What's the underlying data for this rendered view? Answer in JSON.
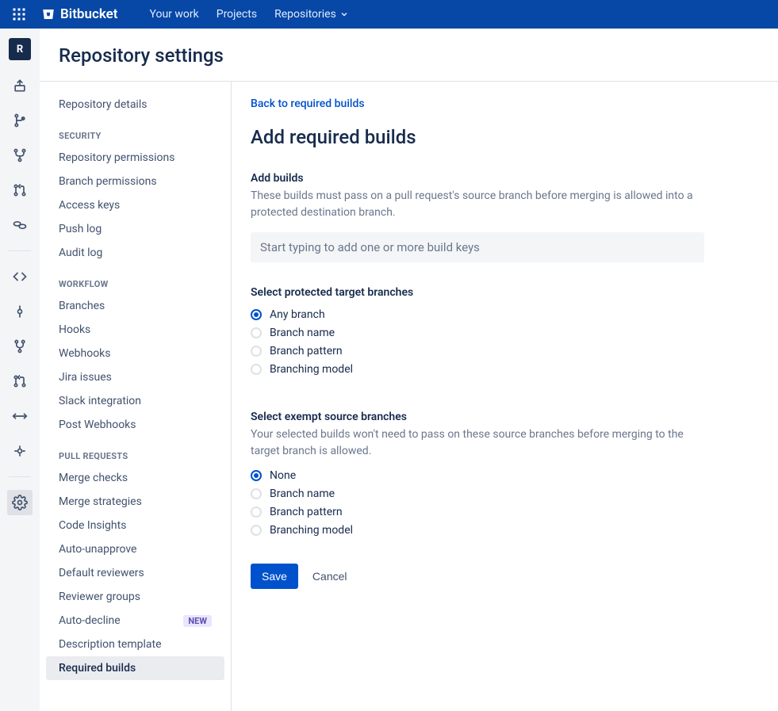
{
  "topbar": {
    "brand": "Bitbucket",
    "nav": {
      "your_work": "Your work",
      "projects": "Projects",
      "repositories": "Repositories"
    }
  },
  "page_title": "Repository settings",
  "iconrail": {
    "project_initial": "R"
  },
  "sidebar": {
    "top_item": "Repository details",
    "security": {
      "header": "SECURITY",
      "items": [
        "Repository permissions",
        "Branch permissions",
        "Access keys",
        "Push log",
        "Audit log"
      ]
    },
    "workflow": {
      "header": "WORKFLOW",
      "items": [
        "Branches",
        "Hooks",
        "Webhooks",
        "Jira issues",
        "Slack integration",
        "Post Webhooks"
      ]
    },
    "pull_requests": {
      "header": "PULL REQUESTS",
      "items": [
        "Merge checks",
        "Merge strategies",
        "Code Insights",
        "Auto-unapprove",
        "Default reviewers",
        "Reviewer groups",
        "Auto-decline",
        "Description template",
        "Required builds"
      ],
      "new_badge": "NEW"
    }
  },
  "main": {
    "backlink": "Back to required builds",
    "title": "Add required builds",
    "add_builds": {
      "heading": "Add builds",
      "desc": "These builds must pass on a pull request's source branch before merging is allowed into a protected destination branch.",
      "placeholder": "Start typing to add one or more build keys"
    },
    "target": {
      "heading": "Select protected target branches",
      "options": [
        "Any branch",
        "Branch name",
        "Branch pattern",
        "Branching model"
      ]
    },
    "exempt": {
      "heading": "Select exempt source branches",
      "desc": "Your selected builds won't need to pass on these source branches before merging to the target branch is allowed.",
      "options": [
        "None",
        "Branch name",
        "Branch pattern",
        "Branching model"
      ]
    },
    "actions": {
      "save": "Save",
      "cancel": "Cancel"
    }
  }
}
